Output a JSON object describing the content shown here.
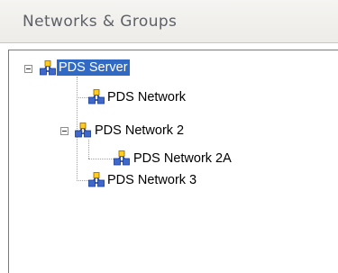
{
  "panel": {
    "title": "Networks & Groups"
  },
  "tree": {
    "root": {
      "label": "PDS Server",
      "expanded": true,
      "selected": true,
      "icon": "network-server-icon"
    },
    "children": [
      {
        "label": "PDS Network",
        "icon": "network-icon"
      },
      {
        "label": "PDS Network 2",
        "icon": "network-icon",
        "expanded": true,
        "children": [
          {
            "label": "PDS Network 2A",
            "icon": "network-icon"
          }
        ]
      },
      {
        "label": "PDS Network 3",
        "icon": "network-icon"
      }
    ]
  },
  "colors": {
    "selection": "#316ac5",
    "header_text": "#5d6067",
    "header_background": "#edece8"
  }
}
